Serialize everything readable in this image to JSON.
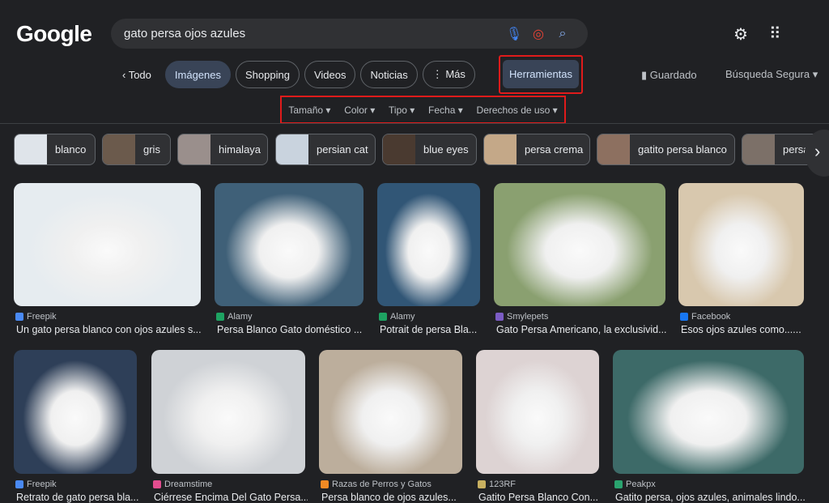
{
  "header": {
    "logo": "Google",
    "query": "gato persa ojos azules",
    "mic_icon": "mic-icon",
    "lens_icon": "lens-icon",
    "search_icon": "search-icon",
    "settings_icon": "gear-icon",
    "apps_icon": "apps-grid-icon"
  },
  "tabs": [
    {
      "label": "‹ Todo"
    },
    {
      "label": "Imágenes",
      "active": true
    },
    {
      "label": "Shopping"
    },
    {
      "label": "Videos"
    },
    {
      "label": "Noticias"
    },
    {
      "label": "⋮ Más"
    }
  ],
  "tools_label": "Herramientas",
  "saved_label": "Guardado",
  "safe_search_label": "Búsqueda Segura ▾",
  "filters": [
    "Tamaño ▾",
    "Color ▾",
    "Tipo ▾",
    "Fecha ▾",
    "Derechos de uso ▾"
  ],
  "chips": [
    "blanco",
    "gris",
    "himalaya",
    "persian cat",
    "blue eyes",
    "persa crema",
    "gatito persa blanco",
    "persa"
  ],
  "results": [
    {
      "source": "Freepik",
      "title": "Un gato persa blanco con ojos azules s...",
      "color": "#e6ecf0",
      "icon": "#4a8af4"
    },
    {
      "source": "Alamy",
      "title": "Persa Blanco Gato doméstico ...",
      "color": "#3f6078",
      "icon": "#1ea362"
    },
    {
      "source": "Alamy",
      "title": "Potrait de persa Bla...",
      "color": "#315676",
      "icon": "#1ea362"
    },
    {
      "source": "Smylepets",
      "title": "Gato Persa Americano, la exclusivid...",
      "color": "#8aa070",
      "icon": "#7b5cc4"
    },
    {
      "source": "Facebook",
      "title": "Esos ojos azules como......",
      "color": "#d8c8ae",
      "icon": "#1877f2"
    },
    {
      "source": "Freepik",
      "title": "Retrato de gato persa bla...",
      "color": "#2e3f58",
      "icon": "#4a8af4"
    },
    {
      "source": "Dreamstime",
      "title": "Ciérrese Encima Del Gato Persa...",
      "color": "#cfd2d6",
      "icon": "#e24d8f"
    },
    {
      "source": "Razas de Perros y Gatos",
      "title": "Persa blanco de ojos azules...",
      "color": "#bcae9c",
      "icon": "#f08a24"
    },
    {
      "source": "123RF",
      "title": "Gatito Persa Blanco Con...",
      "color": "#ddd3d3",
      "icon": "#c8b060"
    },
    {
      "source": "Peakpx",
      "title": "Gatito persa, ojos azules, animales lindo...",
      "color": "#3d6a68",
      "icon": "#2aa36f"
    }
  ]
}
